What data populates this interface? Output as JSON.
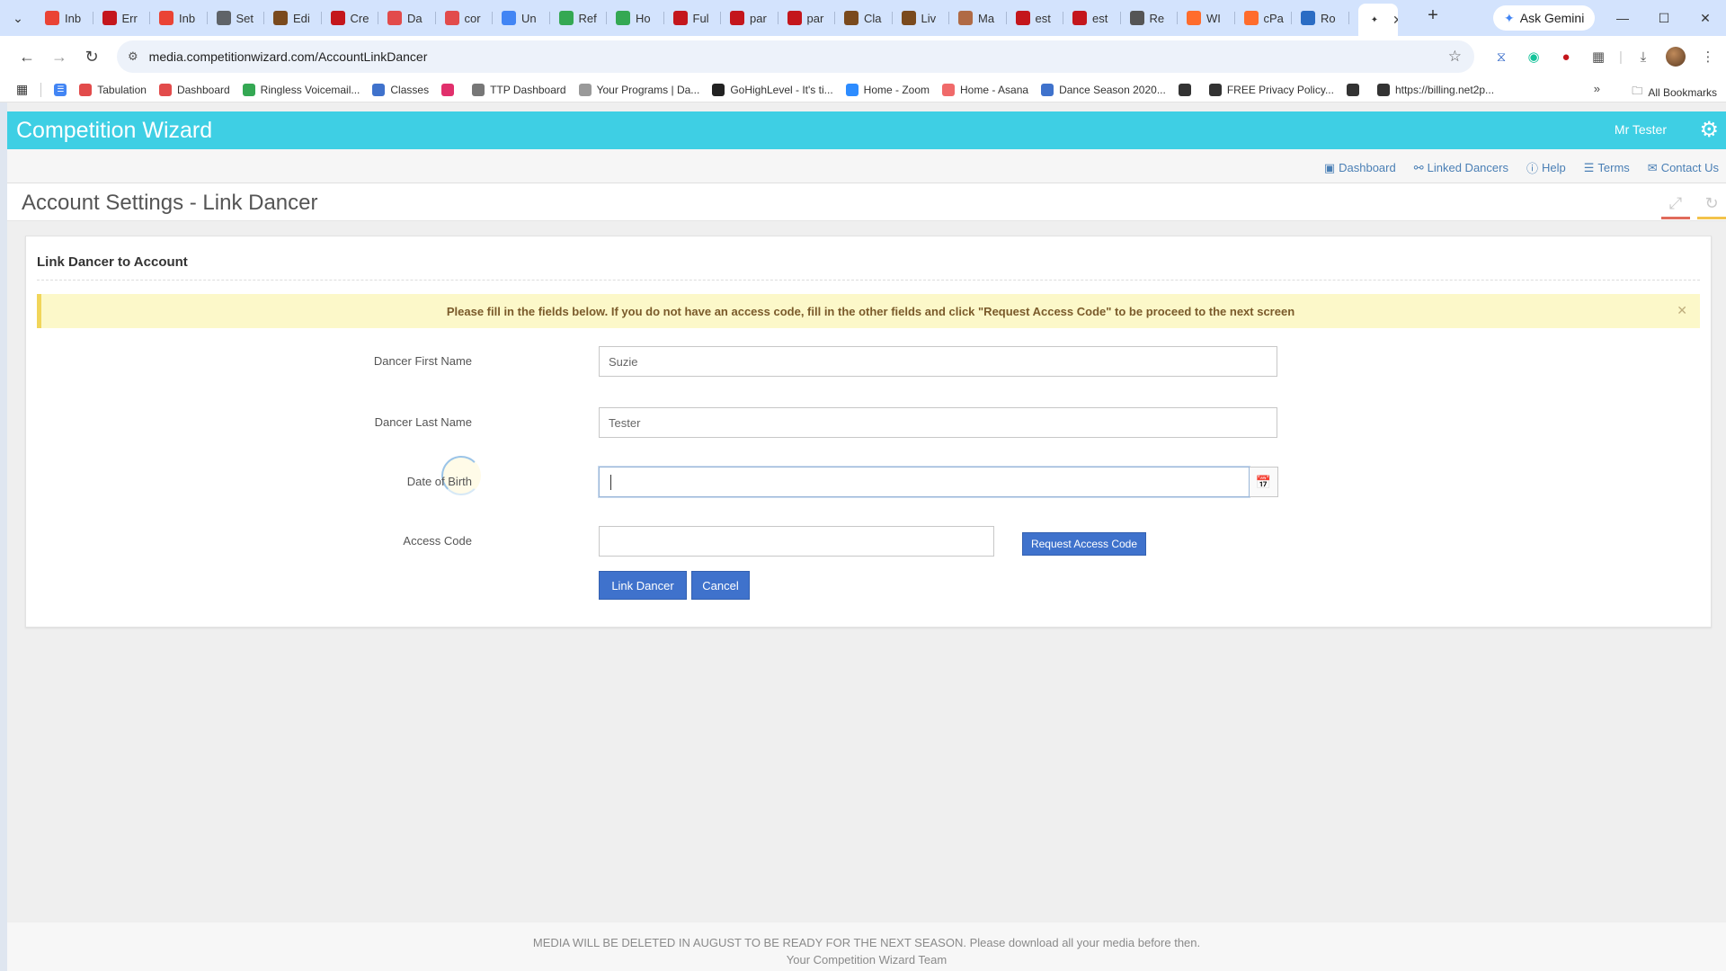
{
  "browser": {
    "tabs": [
      {
        "label": "Inb",
        "icon": "gmail-icon",
        "color": "#ea4335"
      },
      {
        "label": "Err",
        "icon": "adobe-pdf-icon",
        "color": "#c4161c"
      },
      {
        "label": "Inb",
        "icon": "gmail-icon",
        "color": "#ea4335"
      },
      {
        "label": "Set",
        "icon": "settings-icon",
        "color": "#5f6368"
      },
      {
        "label": "Edi",
        "icon": "page-icon",
        "color": "#7a4a1d"
      },
      {
        "label": "Cre",
        "icon": "adobe-pdf-icon",
        "color": "#c4161c"
      },
      {
        "label": "Da",
        "icon": "cross-icon",
        "color": "#e24b4b"
      },
      {
        "label": "cor",
        "icon": "cross-icon",
        "color": "#e24b4b"
      },
      {
        "label": "Un",
        "icon": "docs-icon",
        "color": "#4285f4"
      },
      {
        "label": "Ref",
        "icon": "leaf-icon",
        "color": "#34a853"
      },
      {
        "label": "Ho",
        "icon": "drive-icon",
        "color": "#34a853"
      },
      {
        "label": "Ful",
        "icon": "adobe-pdf-icon",
        "color": "#c4161c"
      },
      {
        "label": "par",
        "icon": "adobe-pdf-icon",
        "color": "#c4161c"
      },
      {
        "label": "par",
        "icon": "adobe-pdf-icon",
        "color": "#c4161c"
      },
      {
        "label": "Cla",
        "icon": "page-icon",
        "color": "#7a4a1d"
      },
      {
        "label": "Liv",
        "icon": "page-icon",
        "color": "#7a4a1d"
      },
      {
        "label": "Ma",
        "icon": "page-icon",
        "color": "#b06a45"
      },
      {
        "label": "est",
        "icon": "adobe-pdf-icon",
        "color": "#c4161c"
      },
      {
        "label": "est",
        "icon": "adobe-pdf-icon",
        "color": "#c4161c"
      },
      {
        "label": "Re",
        "icon": "page-icon",
        "color": "#555555"
      },
      {
        "label": "WI",
        "icon": "cpanel-icon",
        "color": "#ff6c2c"
      },
      {
        "label": "cPa",
        "icon": "cpanel-icon",
        "color": "#ff6c2c"
      },
      {
        "label": "Ro",
        "icon": "globe-icon",
        "color": "#2a6cc4"
      }
    ],
    "ask_gemini": "Ask Gemini",
    "url": "media.competitionwizard.com/AccountLinkDancer",
    "bookmarks": [
      {
        "label": "Tabulation",
        "color": "#e24b4b"
      },
      {
        "label": "Dashboard",
        "color": "#e24b4b"
      },
      {
        "label": "Ringless Voicemail...",
        "color": "#34a853"
      },
      {
        "label": "Classes",
        "color": "#3f72cc"
      },
      {
        "label": "",
        "color": "#e1306c"
      },
      {
        "label": "TTP Dashboard",
        "color": "#777777"
      },
      {
        "label": "Your Programs | Da...",
        "color": "#999999"
      },
      {
        "label": "GoHighLevel - It's ti...",
        "color": "#222222"
      },
      {
        "label": "Home - Zoom",
        "color": "#2d8cff"
      },
      {
        "label": "Home - Asana",
        "color": "#f06a6a"
      },
      {
        "label": "Dance Season 2020...",
        "color": "#3f72cc"
      },
      {
        "label": "",
        "color": "#333333"
      },
      {
        "label": "FREE Privacy Policy...",
        "color": "#333333"
      },
      {
        "label": "",
        "color": "#333333"
      },
      {
        "label": "https://billing.net2p...",
        "color": "#333333"
      }
    ],
    "all_bookmarks": "All Bookmarks"
  },
  "app": {
    "brand": "Competition Wizard",
    "user": "Mr Tester",
    "accent_color": "#3ecfe4",
    "nav": [
      {
        "label": "Dashboard",
        "icon": "dashboard-icon"
      },
      {
        "label": "Linked Dancers",
        "icon": "link-icon"
      },
      {
        "label": "Help",
        "icon": "help-icon"
      },
      {
        "label": "Terms",
        "icon": "document-icon"
      },
      {
        "label": "Contact Us",
        "icon": "envelope-icon"
      }
    ],
    "page_title": "Account Settings - Link Dancer"
  },
  "panel": {
    "title": "Link Dancer to Account",
    "alert": "Please fill in the fields below. If you do not have an access code, fill in the other fields and click \"Request Access Code\" to be proceed to the next screen",
    "fields": {
      "first_name": {
        "label": "Dancer First Name",
        "value": "Suzie"
      },
      "last_name": {
        "label": "Dancer Last Name",
        "value": "Tester"
      },
      "dob": {
        "label": "Date of Birth",
        "value": ""
      },
      "access_code": {
        "label": "Access Code",
        "value": ""
      }
    },
    "buttons": {
      "request": "Request Access Code",
      "link": "Link Dancer",
      "cancel": "Cancel"
    }
  },
  "footer": {
    "line1": "MEDIA WILL BE DELETED IN AUGUST TO BE READY FOR THE NEXT SEASON. Please download all your media before then.",
    "line2": "Your Competition Wizard Team"
  }
}
